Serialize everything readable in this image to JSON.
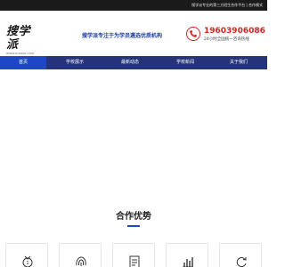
{
  "topbar": {
    "notice": "搜学派专业的第三方招生合作平台 | 合作模式"
  },
  "header": {
    "logo_text": "搜学派",
    "logo_sub": "WWW.SOXPAI.COM",
    "slogan": "搜学派专注于为学员遴选优质机构",
    "phone": "19603906086",
    "phone_sub": "24小时全国统一咨询热线"
  },
  "nav": {
    "items": [
      {
        "label": "首页",
        "active": true
      },
      {
        "label": "学校展示",
        "active": false
      },
      {
        "label": "最新动态",
        "active": false
      },
      {
        "label": "学校新闻",
        "active": false
      },
      {
        "label": "关于我们",
        "active": false
      }
    ]
  },
  "section": {
    "title": "合作优势"
  },
  "cards": [
    {
      "icon": "medal-icon"
    },
    {
      "icon": "fingerprint-icon"
    },
    {
      "icon": "document-icon"
    },
    {
      "icon": "bar-chart-icon"
    },
    {
      "icon": "refresh-icon"
    }
  ],
  "colors": {
    "topbar": "#1a1a1a",
    "nav": "#24337a",
    "nav_active": "#1e47c8",
    "slogan": "#1f3ea6",
    "phone": "#d62222"
  }
}
